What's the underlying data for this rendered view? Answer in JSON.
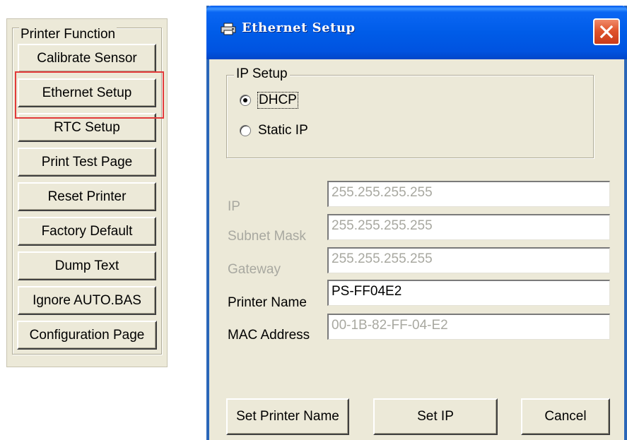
{
  "printer_function": {
    "title": "Printer Function",
    "buttons": [
      {
        "label": "Calibrate Sensor"
      },
      {
        "label": "Ethernet Setup",
        "highlighted": true,
        "highlight_color": "#e23a3a"
      },
      {
        "label": "RTC Setup"
      },
      {
        "label": "Print Test Page"
      },
      {
        "label": "Reset Printer"
      },
      {
        "label": "Factory Default"
      },
      {
        "label": "Dump Text"
      },
      {
        "label": "Ignore AUTO.BAS"
      },
      {
        "label": "Configuration Page"
      }
    ]
  },
  "dialog": {
    "title": "Ethernet Setup",
    "title_icon": "printer-icon",
    "close_icon": "close-icon",
    "titlebar_color": "#0058ee",
    "ip_setup": {
      "legend": "IP Setup",
      "options": [
        {
          "label": "DHCP",
          "checked": true
        },
        {
          "label": "Static IP",
          "checked": false
        }
      ]
    },
    "fields": [
      {
        "label": "IP",
        "value": "255.255.255.255",
        "enabled": false
      },
      {
        "label": "Subnet Mask",
        "value": "255.255.255.255",
        "enabled": false
      },
      {
        "label": "Gateway",
        "value": "255.255.255.255",
        "enabled": false
      },
      {
        "label": "Printer Name",
        "value": "PS-FF04E2",
        "enabled": true
      },
      {
        "label": "MAC Address",
        "value": "00-1B-82-FF-04-E2",
        "enabled": false
      }
    ],
    "buttons": {
      "set_printer_name": "Set Printer Name",
      "set_ip": "Set IP",
      "cancel": "Cancel"
    }
  }
}
